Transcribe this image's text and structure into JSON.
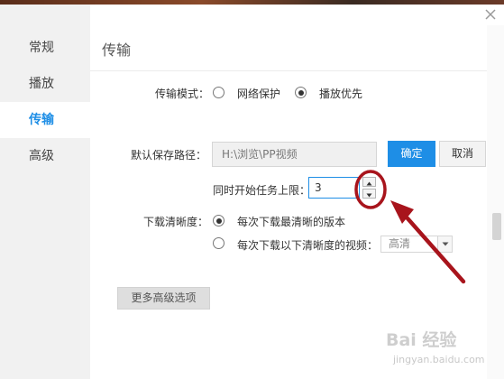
{
  "sidebar": {
    "items": [
      {
        "label": "常规"
      },
      {
        "label": "播放"
      },
      {
        "label": "传输"
      },
      {
        "label": "高级"
      }
    ],
    "active_index": 2
  },
  "section": {
    "title": "传输"
  },
  "transfer_mode": {
    "label": "传输模式：",
    "options": [
      "网络保护",
      "播放优先"
    ],
    "selected": 1
  },
  "save_path": {
    "label": "默认保存路径：",
    "value": "H:\\浏览\\PP视频",
    "confirm_label": "确定",
    "cancel_label": "取消"
  },
  "task_limit": {
    "label": "同时开始任务上限：",
    "value": "3"
  },
  "quality": {
    "label": "下载清晰度：",
    "option_best": "每次下载最清晰的版本",
    "option_below": "每次下载以下清晰度的视频：",
    "selected": 0,
    "select_value": "高清"
  },
  "more_options_label": "更多高级选项",
  "watermark": {
    "text": "Bai 经验",
    "sub": "jingyan.baidu.com"
  },
  "colors": {
    "accent": "#1e8ee6",
    "annotation": "#a8141c"
  }
}
